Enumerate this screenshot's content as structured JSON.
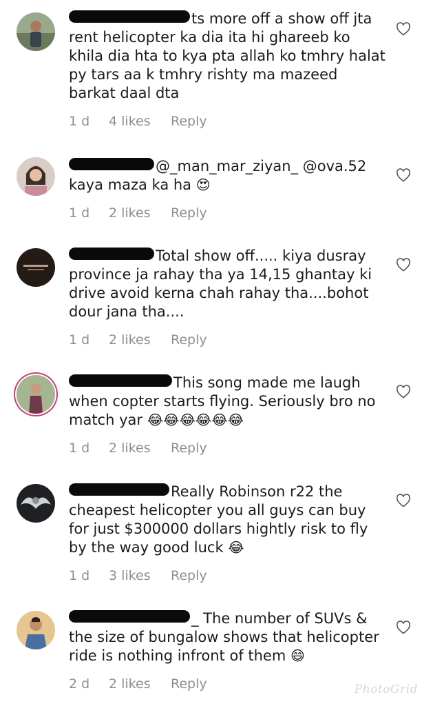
{
  "comments": [
    {
      "text": "ts more off a show off jta rent helicopter ka dia ita hi ghareeb ko khila dia hta to kya pta allah ko tmhry halat py tars aa k tmhry rishty ma mazeed barkat daal dta",
      "time": "1 d",
      "likes": "4 likes",
      "reply": "Reply",
      "avatar_color": "#7b8a6a",
      "emoji": ""
    },
    {
      "text": "@_man_mar_ziyan_ @ova.52 kaya maza ka ha",
      "time": "1 d",
      "likes": "2 likes",
      "reply": "Reply",
      "avatar_color": "#c9b9b0",
      "emoji": "😍"
    },
    {
      "text": "Total show off..... kiya dusray province ja rahay tha ya 14,15 ghantay ki drive avoid kerna chah rahay tha....bohot dour jana tha....",
      "time": "1 d",
      "likes": "2 likes",
      "reply": "Reply",
      "avatar_color": "#2a211c",
      "emoji": ""
    },
    {
      "text": "This song made me laugh when copter starts flying. Seriously bro no match yar",
      "time": "1 d",
      "likes": "2 likes",
      "reply": "Reply",
      "avatar_color": "#8fa07a",
      "emoji": "😂😂😂😂😂😂"
    },
    {
      "text": "Really Robinson r22 the cheapest helicopter you all guys can buy for just $300000 dollars hightly risk to fly by the way good luck",
      "time": "1 d",
      "likes": "3 likes",
      "reply": "Reply",
      "avatar_color": "#4b4b4b",
      "emoji": "😂"
    },
    {
      "text": "_ The number of SUVs & the size of bungalow shows that helicopter ride is nothing infront of them",
      "time": "2 d",
      "likes": "2 likes",
      "reply": "Reply",
      "avatar_color": "#d6a36b",
      "emoji": "😄"
    }
  ],
  "watermark": "PhotoGrid",
  "colors": {
    "meta_text": "#8e8e8e",
    "redaction": "#0a0a0a",
    "story_ring": "#d23a7a"
  }
}
